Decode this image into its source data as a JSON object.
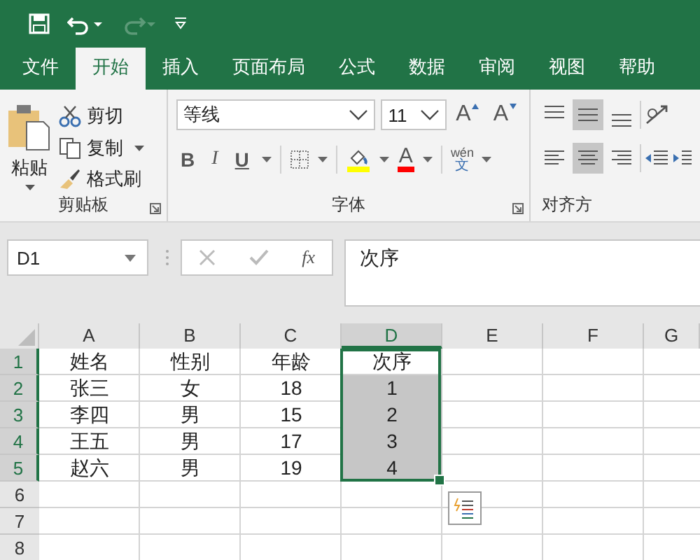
{
  "tabs": [
    {
      "label": "文件",
      "selected": false
    },
    {
      "label": "开始",
      "selected": true
    },
    {
      "label": "插入",
      "selected": false
    },
    {
      "label": "页面布局",
      "selected": false
    },
    {
      "label": "公式",
      "selected": false
    },
    {
      "label": "数据",
      "selected": false
    },
    {
      "label": "审阅",
      "selected": false
    },
    {
      "label": "视图",
      "selected": false
    },
    {
      "label": "帮助",
      "selected": false
    }
  ],
  "clipboard": {
    "paste": "粘贴",
    "cut": "剪切",
    "copy": "复制",
    "format_painter": "格式刷",
    "label": "剪贴板"
  },
  "font": {
    "name": "等线",
    "size": "11",
    "grow": "A",
    "shrink": "A",
    "bold": "B",
    "italic": "I",
    "underline": "U",
    "color_letter": "A",
    "phonetic_top": "wén",
    "phonetic_bottom": "文",
    "label": "字体"
  },
  "alignment": {
    "label": "对齐方"
  },
  "name_box": "D1",
  "fx": "fx",
  "formula": "次序",
  "columns": [
    {
      "label": "A",
      "selected": false
    },
    {
      "label": "B",
      "selected": false
    },
    {
      "label": "C",
      "selected": false
    },
    {
      "label": "D",
      "selected": true
    },
    {
      "label": "E",
      "selected": false
    },
    {
      "label": "F",
      "selected": false
    },
    {
      "label": "G",
      "selected": false
    }
  ],
  "rows": [
    {
      "header": "1",
      "selected": true,
      "cells": [
        "姓名",
        "性别",
        "年龄",
        "次序"
      ]
    },
    {
      "header": "2",
      "selected": true,
      "cells": [
        "张三",
        "女",
        "18",
        "1"
      ]
    },
    {
      "header": "3",
      "selected": true,
      "cells": [
        "李四",
        "男",
        "15",
        "2"
      ]
    },
    {
      "header": "4",
      "selected": true,
      "cells": [
        "王五",
        "男",
        "17",
        "3"
      ]
    },
    {
      "header": "5",
      "selected": true,
      "cells": [
        "赵六",
        "男",
        "19",
        "4"
      ]
    },
    {
      "header": "6",
      "selected": false
    },
    {
      "header": "7",
      "selected": false
    },
    {
      "header": "8",
      "selected": false
    }
  ]
}
